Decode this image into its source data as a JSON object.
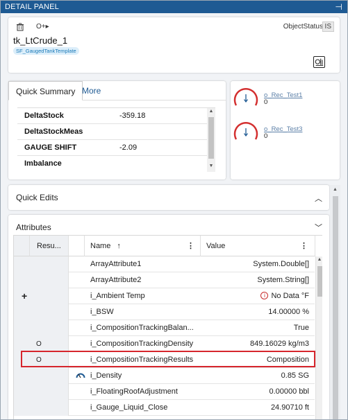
{
  "panel": {
    "title": "DETAIL PANEL",
    "pin_icon": "pin-icon"
  },
  "header": {
    "delete_icon": "trash-icon",
    "sequence_icon": "sequence-icon",
    "sequence_glyph": "O+▸",
    "object_status_label": "ObjectStatus",
    "status_badge": "IS",
    "object_name": "tk_LtCrude_1",
    "template": "SF_GaugedTankTemplate",
    "tank_icon": "tank-gauge-icon"
  },
  "quick_summary": {
    "tabs": [
      {
        "label": "Quick Summary",
        "active": true
      },
      {
        "label": "More",
        "active": false
      }
    ],
    "rows": [
      {
        "name": "DeltaStock",
        "value": "-359.18"
      },
      {
        "name": "DeltaStockMeas",
        "value": ""
      },
      {
        "name": "GAUGE SHIFT",
        "value": "-2.09"
      },
      {
        "name": "Imbalance",
        "value": ""
      }
    ]
  },
  "gauges": [
    {
      "name": "o_Rec_Test1",
      "value": "0"
    },
    {
      "name": "o_Rec_Test3",
      "value": "0"
    }
  ],
  "quick_edits": {
    "title": "Quick Edits",
    "expanded": false
  },
  "attributes": {
    "title": "Attributes",
    "expanded": true,
    "columns": {
      "result": "Resu...",
      "name": "Name",
      "sort_indicator": "↑",
      "value": "Value"
    },
    "rows": [
      {
        "marker": "",
        "name": "ArrayAttribute1",
        "value": "System.Double[]"
      },
      {
        "marker": "",
        "name": "ArrayAttribute2",
        "value": "System.String[]"
      },
      {
        "marker": "+",
        "name": "i_Ambient Temp",
        "value": "No Data °F",
        "warning": true
      },
      {
        "marker": "",
        "name": "i_BSW",
        "value": "14.00000 %"
      },
      {
        "marker": "",
        "name": "i_CompositionTrackingBalan...",
        "value": "True"
      },
      {
        "marker": "O",
        "name": "i_CompositionTrackingDensity",
        "value": "849.16029 kg/m3"
      },
      {
        "marker": "O",
        "name": "i_CompositionTrackingResults",
        "value": "Composition",
        "highlighted": true
      },
      {
        "marker": "",
        "name": "i_Density",
        "value": "0.85 SG",
        "icon": "gauge-icon"
      },
      {
        "marker": "",
        "name": "i_FloatingRoofAdjustment",
        "value": "0.00000 bbl"
      },
      {
        "marker": "",
        "name": "i_Gauge_Liquid_Close",
        "value": "24.90710 ft"
      }
    ]
  },
  "colors": {
    "title_bar": "#1e5a93",
    "highlight_border": "#d6252c",
    "gauge_arc": "#d32f2f",
    "link": "#5b7fa7"
  }
}
